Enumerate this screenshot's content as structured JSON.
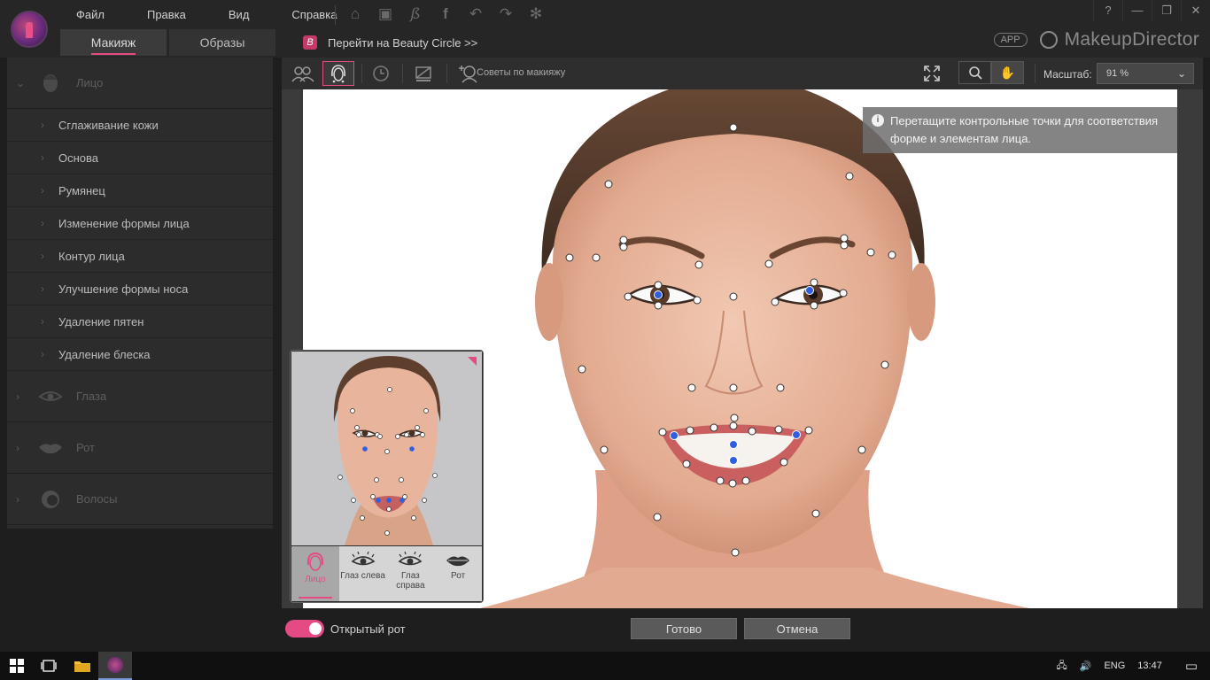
{
  "menu": [
    "Файл",
    "Правка",
    "Вид",
    "Справка"
  ],
  "quick_icons": [
    "home-icon",
    "save-icon",
    "beauty-circle-icon",
    "facebook-icon",
    "undo-icon",
    "redo-icon",
    "settings-icon"
  ],
  "window_buttons": [
    "?",
    "—",
    "❐",
    "✕"
  ],
  "tabs": [
    "Макияж",
    "Образы"
  ],
  "beauty_circle": {
    "icon": "B",
    "label": "Перейти на Beauty Circle >>"
  },
  "brand": {
    "app_badge": "APP",
    "name": "MakeupDirector"
  },
  "sidebar": {
    "face_label": "Лицо",
    "face_items": [
      "Сглаживание кожи",
      "Основа",
      "Румянец",
      "Изменение формы лица",
      "Контур лица",
      "Улучшение формы носа",
      "Удаление пятен",
      "Удаление блеска"
    ],
    "sections": [
      {
        "label": "Глаза",
        "icon": "eye-icon"
      },
      {
        "label": "Рот",
        "icon": "lips-icon"
      },
      {
        "label": "Волосы",
        "icon": "hair-icon"
      }
    ]
  },
  "toolbar": {
    "tips_label": "Советы по макияжу",
    "scale_label": "Масштаб:",
    "scale_value": "91 %"
  },
  "hint": {
    "icon": "i",
    "text": "Перетащите контрольные точки для соответствия форме и элементам лица."
  },
  "preview": {
    "tabs": [
      {
        "label": "Лицо",
        "icon": "face-icon",
        "active": true
      },
      {
        "label": "Глаз слева",
        "icon": "eye-icon",
        "active": false
      },
      {
        "label": "Глаз справа",
        "icon": "eye-icon",
        "active": false
      },
      {
        "label": "Рот",
        "icon": "lips-icon",
        "active": false
      }
    ]
  },
  "bottom": {
    "toggle_label": "Открытый рот",
    "done": "Готово",
    "cancel": "Отмена"
  },
  "taskbar": {
    "lang": "ENG",
    "time": "13:47"
  },
  "colors": {
    "accent": "#e44b85",
    "control_point_blue": "#2f5fe0"
  }
}
